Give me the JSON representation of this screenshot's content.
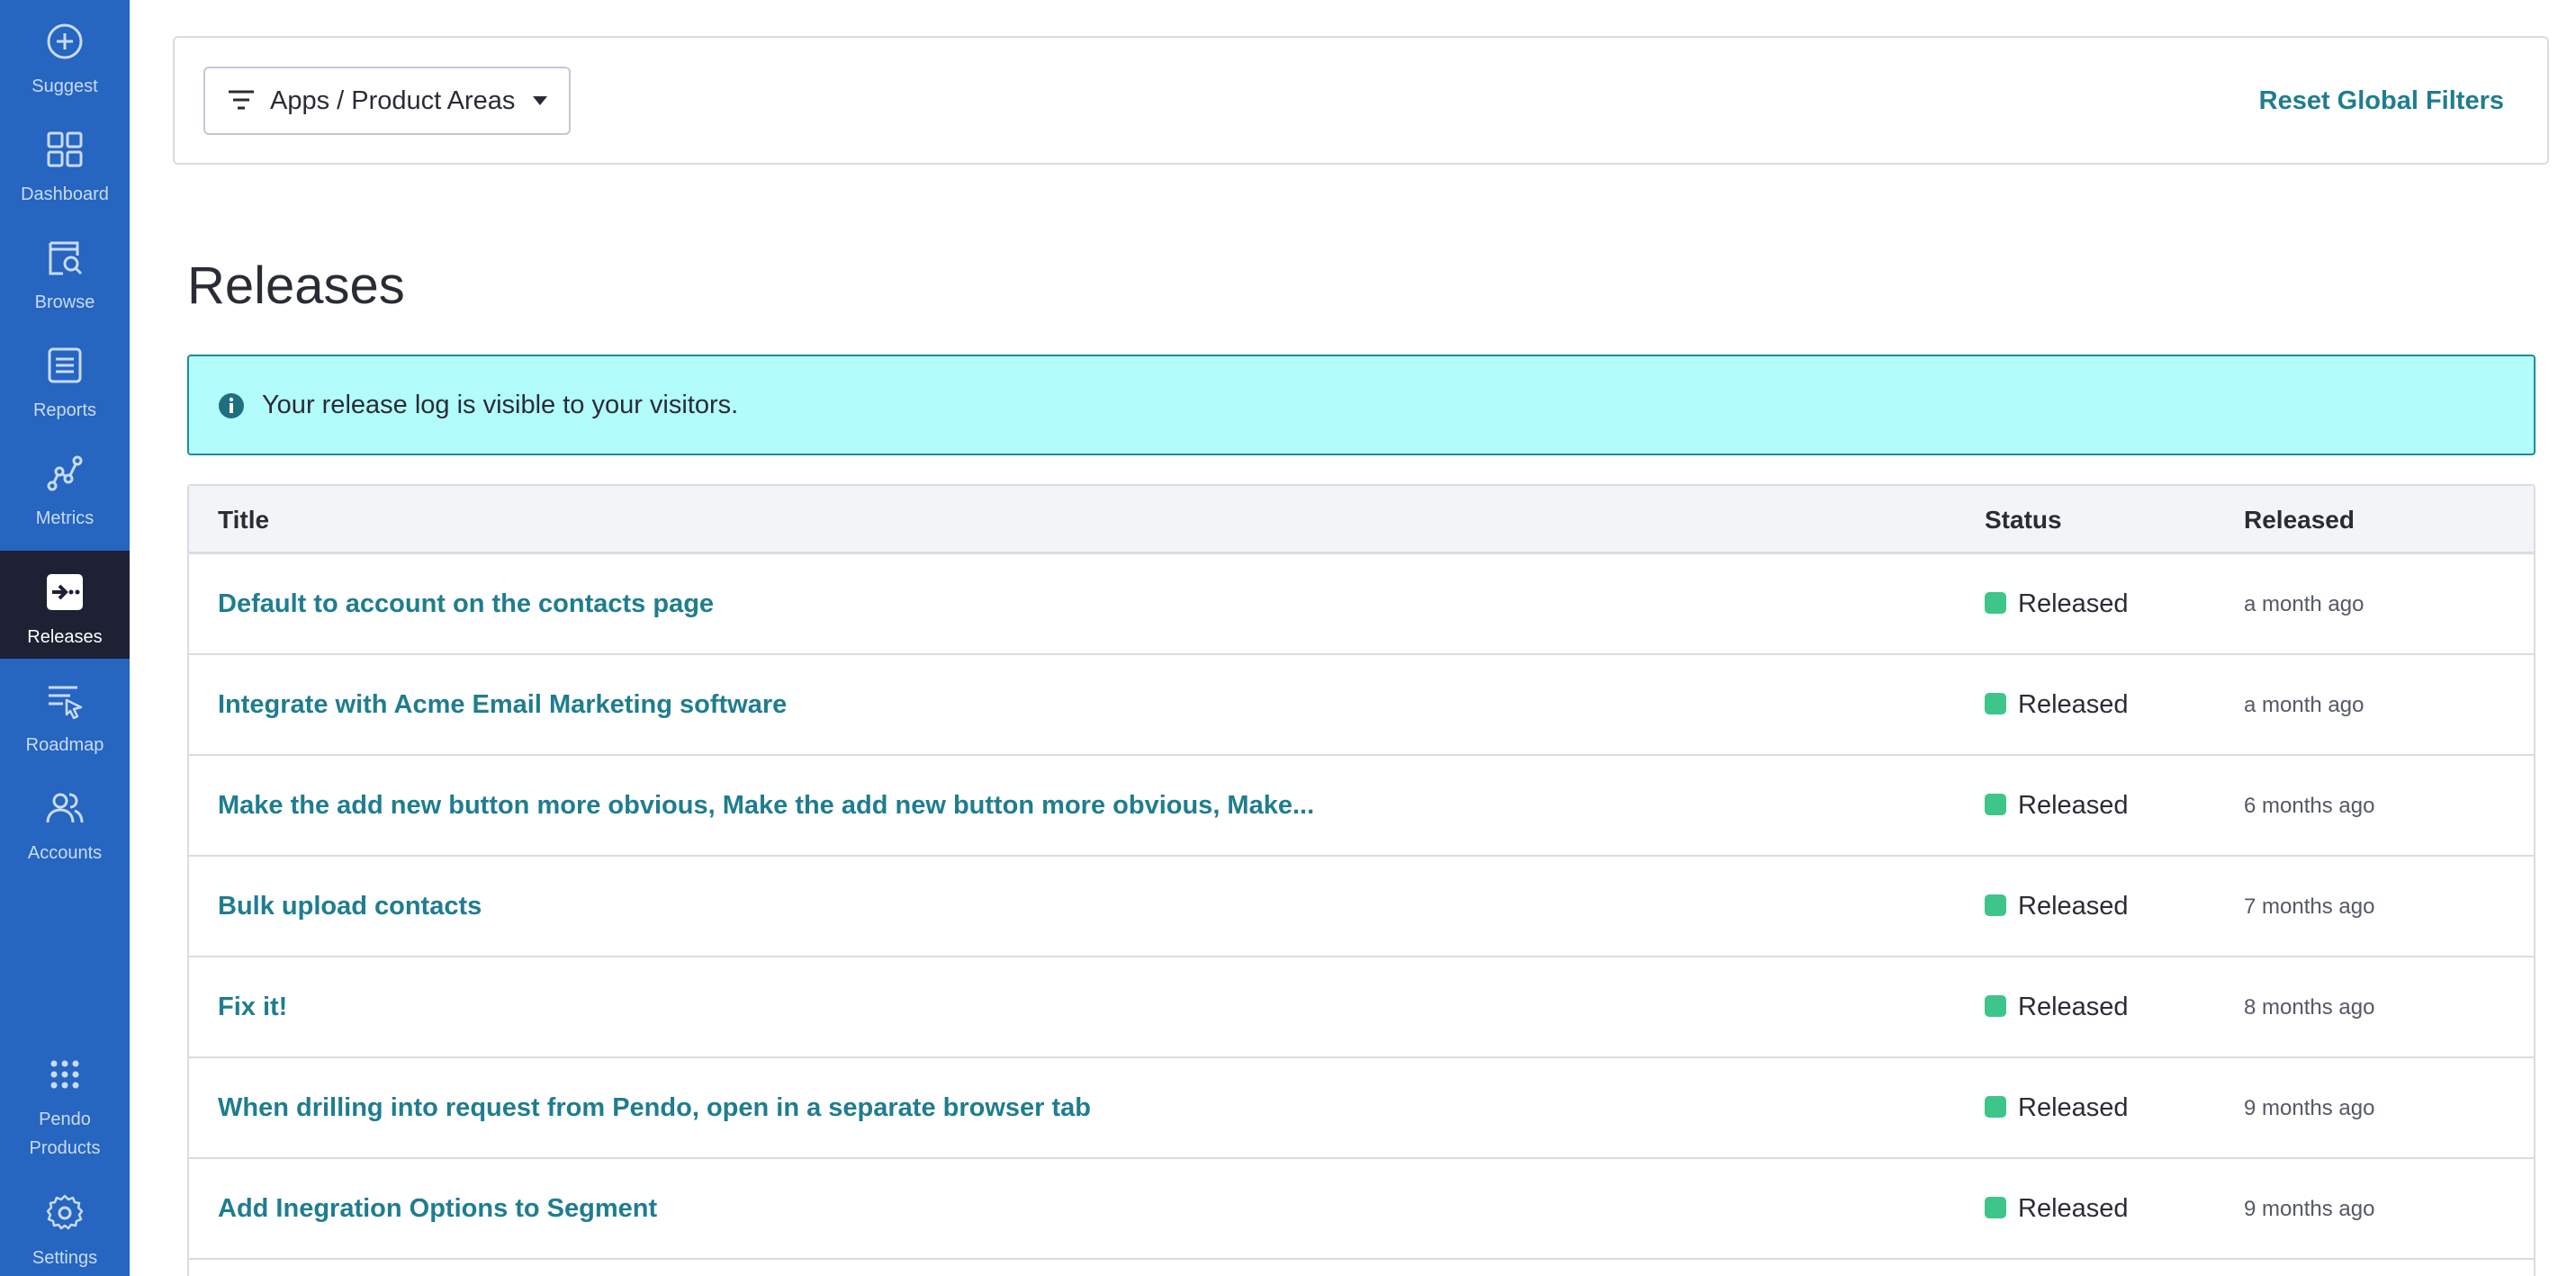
{
  "colors": {
    "sidebar": "#2665c0",
    "sidebar_active": "#1e2033",
    "link": "#1f7d8f",
    "banner_bg": "#b2fcfc",
    "banner_border": "#1f8b9b",
    "status_released": "#3ec58a"
  },
  "sidebar": {
    "items": [
      {
        "label": "Suggest",
        "icon": "plus-circle-icon"
      },
      {
        "label": "Dashboard",
        "icon": "grid-icon"
      },
      {
        "label": "Browse",
        "icon": "browse-search-icon"
      },
      {
        "label": "Reports",
        "icon": "list-doc-icon"
      },
      {
        "label": "Metrics",
        "icon": "metrics-graph-icon"
      },
      {
        "label": "Releases",
        "icon": "releases-icon",
        "active": true
      },
      {
        "label": "Roadmap",
        "icon": "roadmap-icon"
      },
      {
        "label": "Accounts",
        "icon": "users-icon"
      }
    ],
    "bottom_items": [
      {
        "label_line1": "Pendo",
        "label_line2": "Products",
        "icon": "apps-grid-dots-icon"
      },
      {
        "label": "Settings",
        "icon": "gear-icon"
      }
    ]
  },
  "filters": {
    "dropdown_label": "Apps / Product Areas",
    "reset_label": "Reset Global Filters"
  },
  "page": {
    "title": "Releases",
    "banner_text": "Your release log is visible to your visitors."
  },
  "table": {
    "headers": {
      "title": "Title",
      "status": "Status",
      "released": "Released"
    },
    "rows": [
      {
        "title": "Default to account on the contacts page",
        "status": "Released",
        "released": "a month ago"
      },
      {
        "title": "Integrate with Acme Email Marketing software",
        "status": "Released",
        "released": "a month ago"
      },
      {
        "title": "Make the add new button more obvious, Make the add new button more obvious, Make...",
        "status": "Released",
        "released": "6 months ago"
      },
      {
        "title": "Bulk upload contacts",
        "status": "Released",
        "released": "7 months ago"
      },
      {
        "title": "Fix it!",
        "status": "Released",
        "released": "8 months ago"
      },
      {
        "title": "When drilling into request from Pendo, open in a separate browser tab",
        "status": "Released",
        "released": "9 months ago"
      },
      {
        "title": "Add Inegration Options to Segment",
        "status": "Released",
        "released": "9 months ago"
      }
    ]
  }
}
